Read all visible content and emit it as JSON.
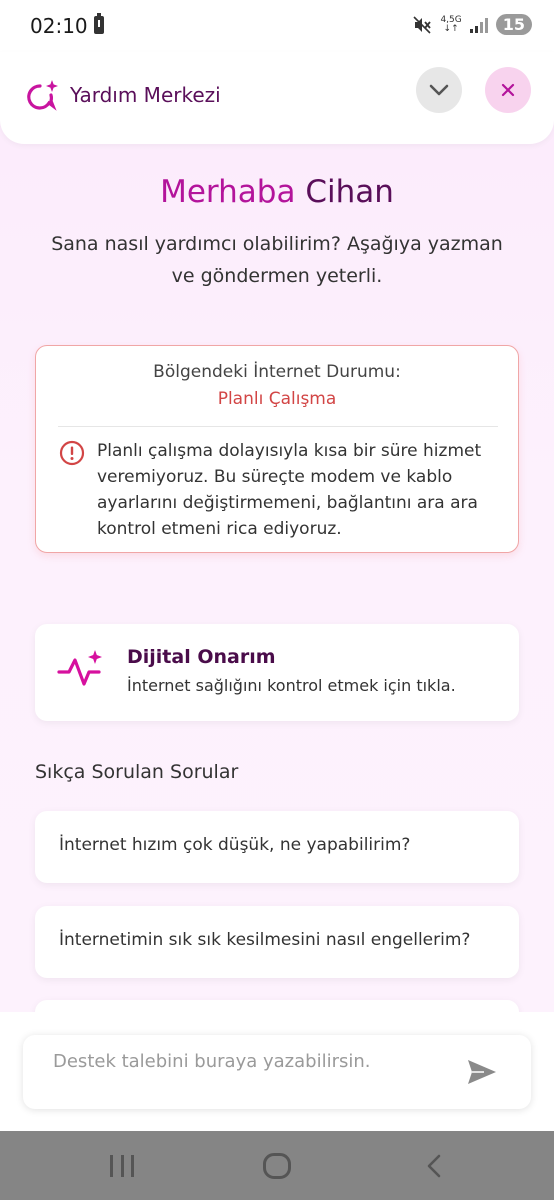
{
  "status_bar": {
    "time": "02:10",
    "network": "4,5G",
    "battery": "15",
    "icons": [
      "battery-alert-icon",
      "mute-icon",
      "signal-icon"
    ]
  },
  "header": {
    "title": "Yardım Merkezi",
    "logo_icon": "chat-sparkle-icon",
    "collapse_icon": "chevron-down-icon",
    "close_icon": "close-icon"
  },
  "greeting": {
    "hello": "Merhaba",
    "name": "Cihan",
    "subtitle": "Sana nasıl yardımcı olabilirim? Aşağıya yazman ve göndermen yeterli."
  },
  "alert": {
    "title": "Bölgendeki İnternet Durumu:",
    "status": "Planlı Çalışma",
    "message": "Planlı çalışma dolayısıyla kısa bir süre hizmet veremiyoruz. Bu süreçte modem ve kablo ayarlarını değiştirmemeni, bağlantını ara ara kontrol etmeni rica ediyoruz.",
    "icon": "info-icon"
  },
  "repair": {
    "title": "Dijital Onarım",
    "subtitle": "İnternet sağlığını kontrol etmek için tıkla.",
    "icon": "pulse-sparkle-icon"
  },
  "faq": {
    "heading": "Sıkça Sorulan Sorular",
    "items": [
      "İnternet hızım çok düşük, ne yapabilirim?",
      "İnternetimin sık sık kesilmesini nasıl engellerim?",
      ""
    ]
  },
  "input": {
    "placeholder": "Destek talebini buraya yazabilirsin.",
    "send_icon": "send-icon"
  },
  "colors": {
    "brand_magenta": "#b3149b",
    "brand_dark": "#5a0f5a",
    "alert_red": "#d24545",
    "close_bg": "#f8d3ee"
  }
}
